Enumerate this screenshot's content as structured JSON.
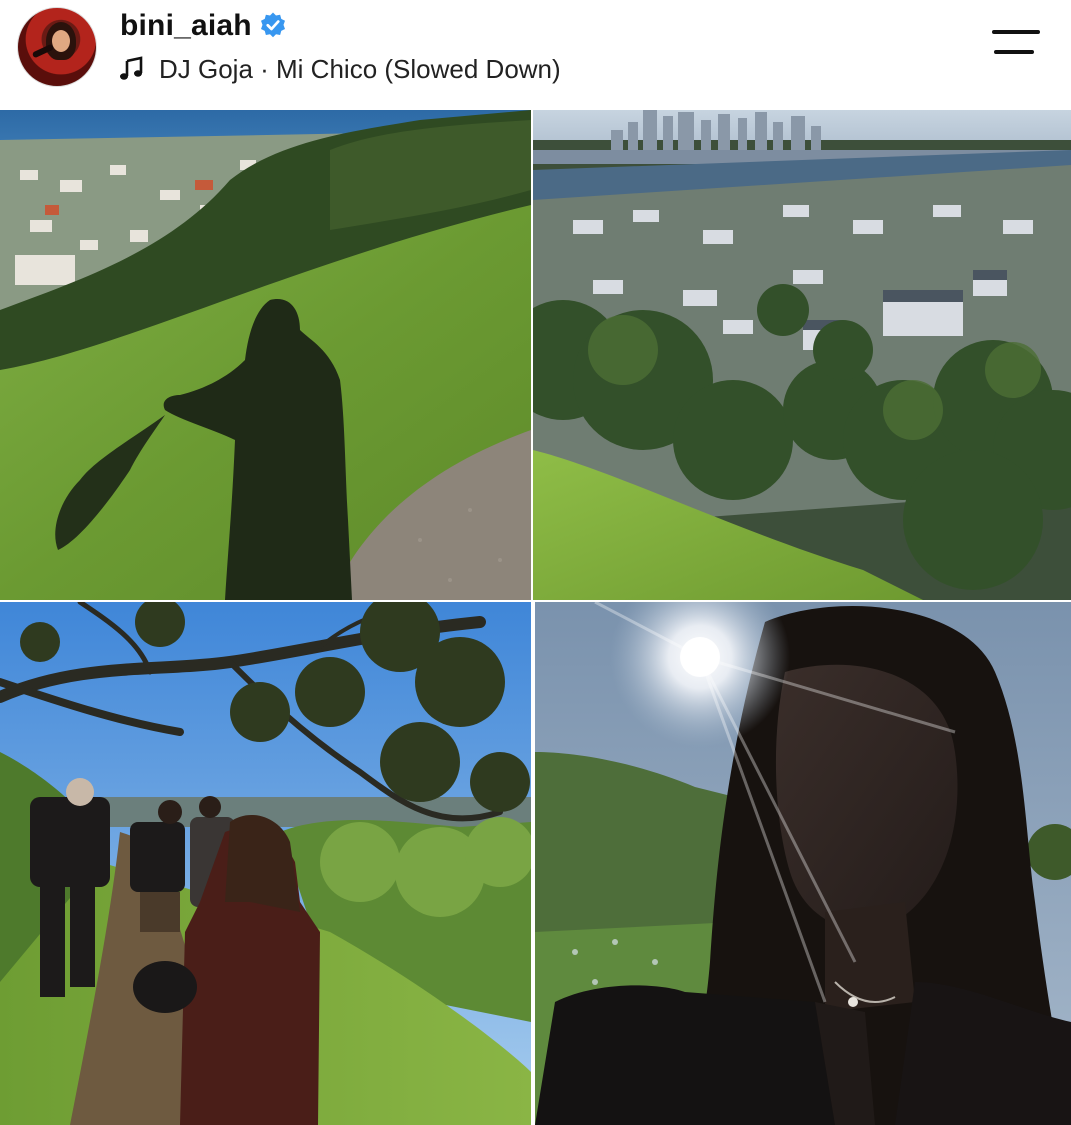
{
  "post_header": {
    "username": "bini_aiah",
    "verified": true,
    "verified_badge_color": "#3897f0",
    "audio_label": "DJ Goja · Mi Chico (Slowed Down)",
    "audio_icon": "music-note-icon",
    "menu_icon": "menu-icon"
  },
  "photos": [
    {
      "subject": "shadow on grassy hill",
      "colors": [
        "#6f9b3a",
        "#2f3d1e",
        "#3a6fa8"
      ]
    },
    {
      "subject": "city skyline and harbor over suburbs",
      "colors": [
        "#3f5a78",
        "#44612c",
        "#8ab64a"
      ]
    },
    {
      "subject": "group hiking down grassy path",
      "colors": [
        "#5aa0e6",
        "#6a9b34",
        "#2a1c14"
      ]
    },
    {
      "subject": "selfie with sunburst",
      "colors": [
        "#6e86a2",
        "#1a1614",
        "#4a6a3a"
      ]
    }
  ]
}
